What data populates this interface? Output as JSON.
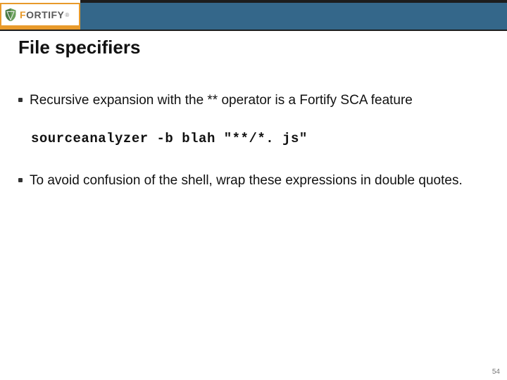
{
  "brand": {
    "name_head": "F",
    "name_rest": "ORTIFY",
    "registered": "®"
  },
  "title": "File specifiers",
  "bullets": [
    "Recursive expansion with the ** operator is a Fortify SCA feature",
    "To avoid confusion of the shell, wrap these expressions in double quotes."
  ],
  "code": "sourceanalyzer -b blah \"**/*. js\"",
  "page_number": "54"
}
